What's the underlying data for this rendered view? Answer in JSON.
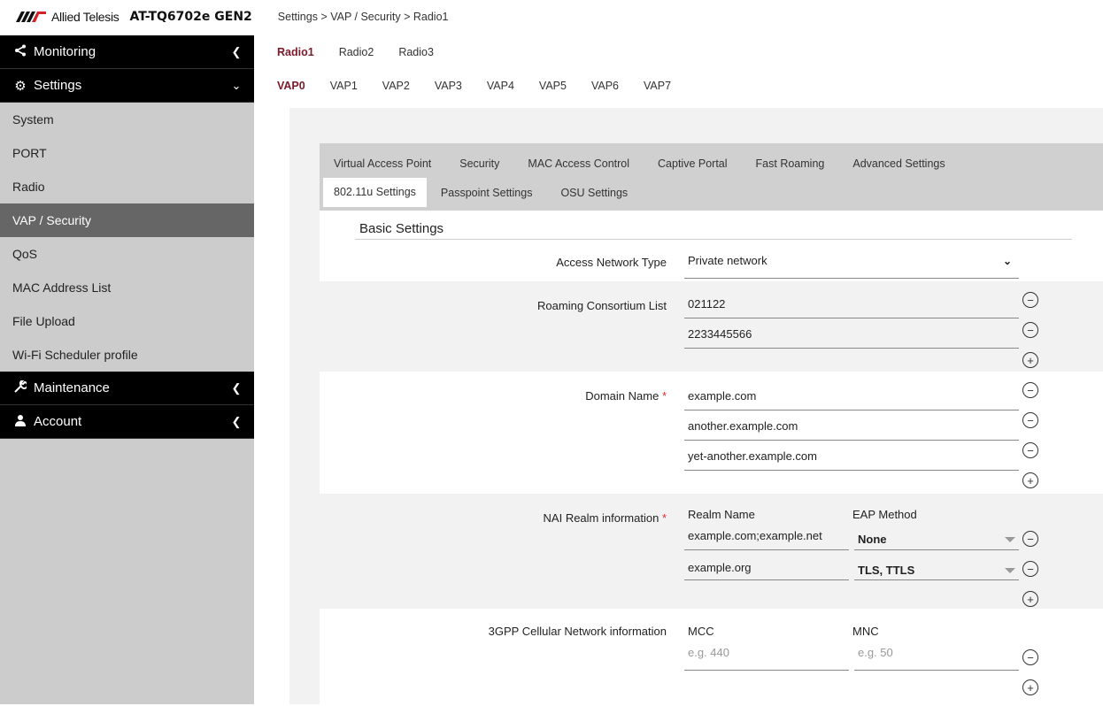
{
  "header": {
    "logo_text": "Allied Telesis",
    "model": "AT-TQ6702e GEN2",
    "breadcrumb": "Settings > VAP / Security > Radio1"
  },
  "sidebar": {
    "monitoring": "Monitoring",
    "settings": "Settings",
    "items": [
      "System",
      "PORT",
      "Radio",
      "VAP / Security",
      "QoS",
      "MAC Address List",
      "File Upload",
      "Wi-Fi Scheduler profile"
    ],
    "maintenance": "Maintenance",
    "account": "Account"
  },
  "radio_tabs": [
    "Radio1",
    "Radio2",
    "Radio3"
  ],
  "vap_tabs": [
    "VAP0",
    "VAP1",
    "VAP2",
    "VAP3",
    "VAP4",
    "VAP5",
    "VAP6",
    "VAP7"
  ],
  "sub_tabs_row1": [
    "Virtual Access Point",
    "Security",
    "MAC Access Control",
    "Captive Portal",
    "Fast Roaming",
    "Advanced Settings"
  ],
  "sub_tabs_row2": [
    "802.11u Settings",
    "Passpoint Settings",
    "OSU Settings"
  ],
  "form": {
    "section_title": "Basic Settings",
    "access_network_type": {
      "label": "Access Network Type",
      "value": "Private network"
    },
    "roaming_consortium": {
      "label": "Roaming Consortium List",
      "values": [
        "021122",
        "2233445566"
      ]
    },
    "domain_name": {
      "label": "Domain Name",
      "required": "*",
      "values": [
        "example.com",
        "another.example.com",
        "yet-another.example.com"
      ]
    },
    "nai_realm": {
      "label": "NAI Realm information",
      "required": "*",
      "col_realm": "Realm Name",
      "col_eap": "EAP Method",
      "rows": [
        {
          "realm": "example.com;example.net",
          "eap": "None"
        },
        {
          "realm": "example.org",
          "eap": "TLS, TTLS"
        }
      ]
    },
    "cellular": {
      "label": "3GPP Cellular Network information",
      "col_mcc": "MCC",
      "col_mnc": "MNC",
      "mcc_placeholder": "e.g. 440",
      "mnc_placeholder": "e.g. 50"
    }
  }
}
